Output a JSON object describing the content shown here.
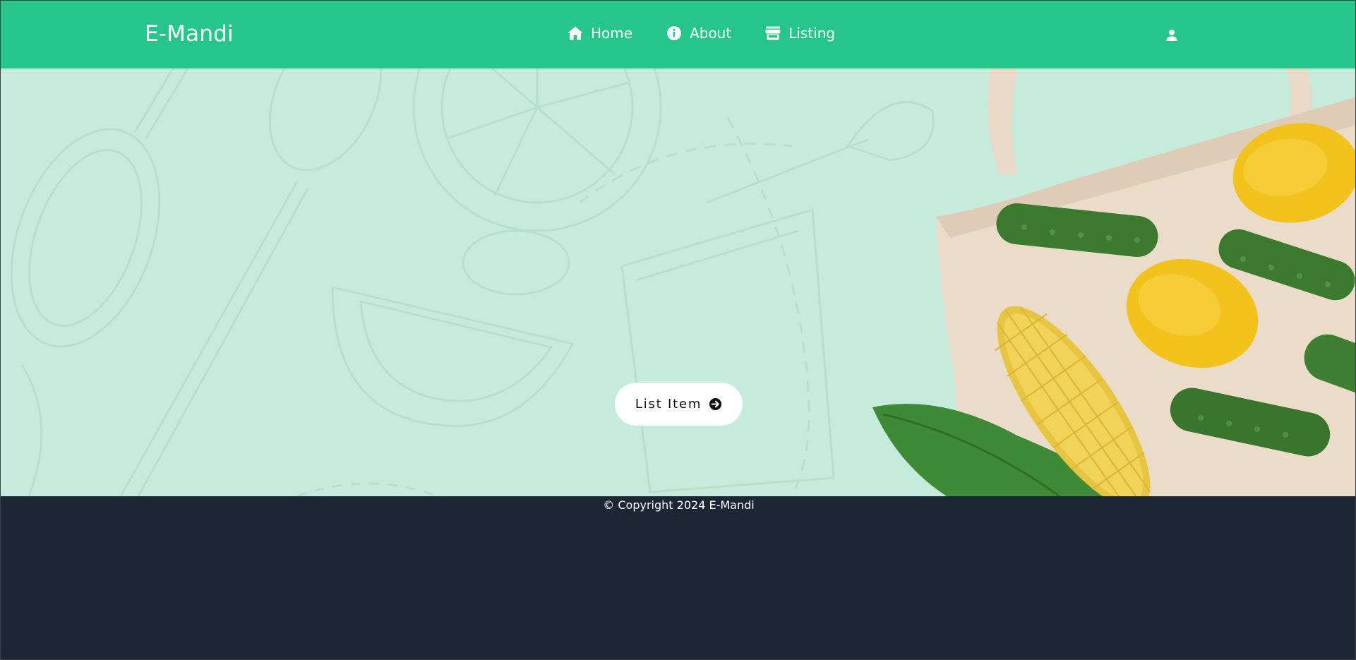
{
  "brand": "E-Mandi",
  "nav": {
    "items": [
      {
        "label": "Home",
        "icon": "home-icon"
      },
      {
        "label": "About",
        "icon": "info-icon"
      },
      {
        "label": "Listing",
        "icon": "store-icon"
      }
    ],
    "user_icon": "user-icon"
  },
  "hero": {
    "cta_label": "List Item",
    "cta_icon": "arrow-circle-right-icon",
    "background_color": "#c5ebdc"
  },
  "footer": {
    "copyright": "© Copyright 2024 E-Mandi"
  },
  "colors": {
    "navbar": "#26c68a",
    "footer": "#1e2635",
    "cta_background": "#ffffff"
  }
}
